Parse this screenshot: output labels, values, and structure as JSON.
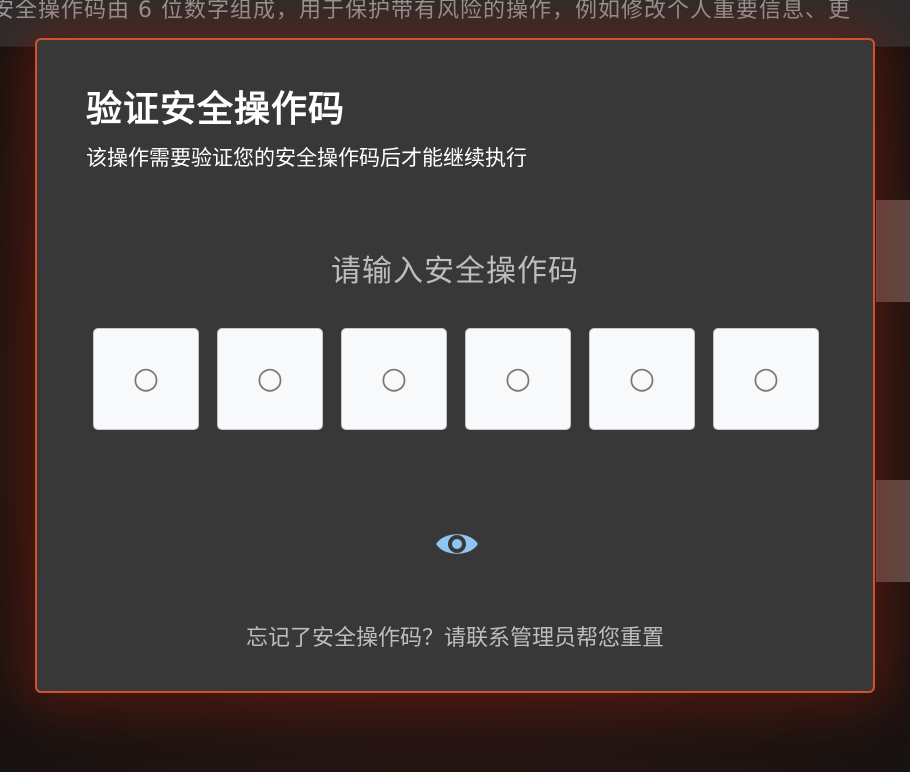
{
  "background": {
    "top_strip_text": "安全操作码由 6 位数字组成，用于保护带有风险的操作，例如修改个人重要信息、更"
  },
  "dialog": {
    "title": "验证安全操作码",
    "subtitle": "该操作需要验证您的安全操作码后才能继续执行",
    "prompt": "请输入安全操作码",
    "code_boxes": [
      {
        "placeholder": "○"
      },
      {
        "placeholder": "○"
      },
      {
        "placeholder": "○"
      },
      {
        "placeholder": "○"
      },
      {
        "placeholder": "○"
      },
      {
        "placeholder": "○"
      }
    ],
    "toggle_visibility_icon": "eye-icon",
    "footer_hint": "忘记了安全操作码？请联系管理员帮您重置"
  },
  "colors": {
    "dialog_border": "#d2512e",
    "dialog_background": "#383838",
    "eye_icon": "#8ec5f5",
    "code_box_background": "#f8f9fb"
  }
}
